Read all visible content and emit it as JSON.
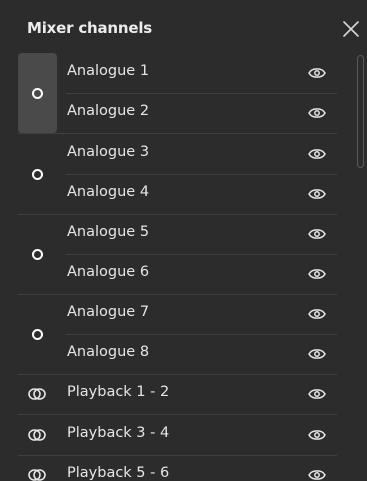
{
  "panel": {
    "title": "Mixer channels"
  },
  "channels": [
    {
      "label": "Analogue 1"
    },
    {
      "label": "Analogue 2"
    },
    {
      "label": "Analogue 3"
    },
    {
      "label": "Analogue 4"
    },
    {
      "label": "Analogue 5"
    },
    {
      "label": "Analogue 6"
    },
    {
      "label": "Analogue 7"
    },
    {
      "label": "Analogue 8"
    }
  ],
  "playback": [
    {
      "label": "Playback 1 - 2"
    },
    {
      "label": "Playback 3 - 4"
    },
    {
      "label": "Playback 5 - 6"
    }
  ],
  "icons": {
    "close": "close-icon",
    "visibility": "eye-icon",
    "link": "link-ring-icon",
    "stereo": "stereo-link-icon"
  },
  "colors": {
    "background": "#2c2c2c",
    "active_cell": "#4a4a4a",
    "divider": "#3f3f3f",
    "text": "#e6e6e6"
  }
}
